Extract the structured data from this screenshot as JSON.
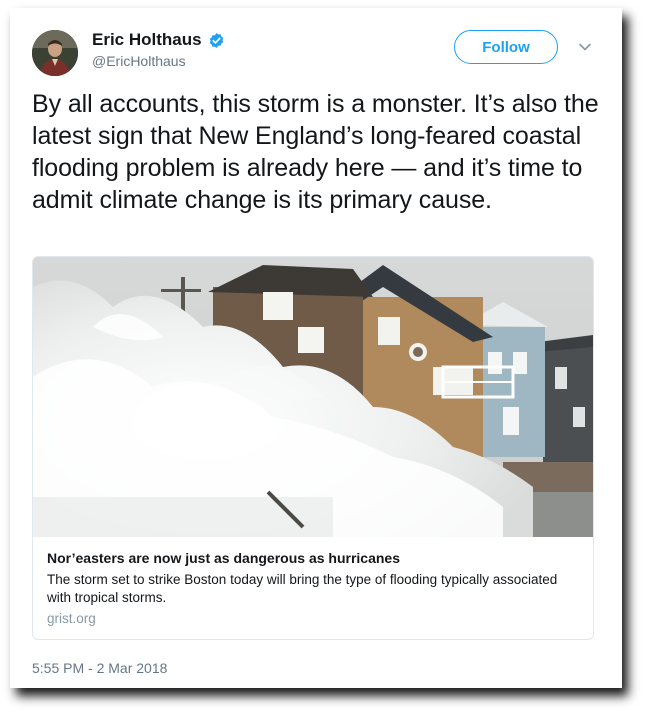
{
  "tweet": {
    "author_name": "Eric Holthaus",
    "handle": "@EricHolthaus",
    "follow_label": "Follow",
    "text": "By all accounts, this storm is a monster. It’s also the latest sign that New England’s long-feared coastal flooding problem is already here — and it’s time to admit climate change is its primary cause.",
    "timestamp": "5:55 PM - 2 Mar 2018"
  },
  "card": {
    "title": "Nor’easters are now just as dangerous as hurricanes",
    "description": "The storm set to strike Boston today will bring the type of flooding typically associated with tropical storms.",
    "domain": "grist.org"
  },
  "icons": {
    "verified": "verified-badge-icon",
    "caret": "chevron-down-icon"
  },
  "colors": {
    "accent": "#1da1f2",
    "secondary_text": "#657786",
    "primary_text": "#14171a"
  }
}
